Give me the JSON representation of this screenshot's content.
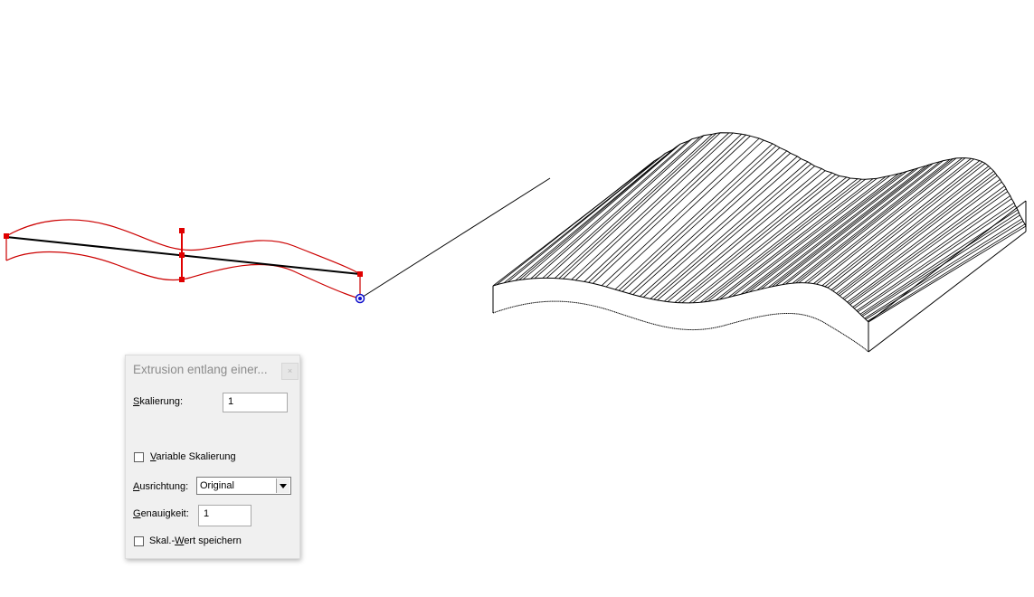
{
  "dialog": {
    "title": "Extrusion entlang einer...",
    "close_glyph": "×",
    "skalierung": {
      "key": "S",
      "rest": "kalierung:",
      "value": "1"
    },
    "variable_skalierung": {
      "key": "V",
      "rest": "ariable Skalierung",
      "checked": false
    },
    "ausrichtung": {
      "key": "A",
      "rest": "usrichtung:",
      "value": "Original"
    },
    "genauigkeit": {
      "key": "G",
      "rest": "enauigkeit:",
      "value": "1"
    },
    "wert_speichern": {
      "pre": "Skal.-",
      "key": "W",
      "rest": "ert speichern",
      "checked": false
    }
  },
  "colors": {
    "profile_red": "#cc0000",
    "handle_red": "#e00000",
    "base_point_blue": "#1010cc",
    "line_black": "#000000"
  },
  "icons": {
    "close": "close-icon",
    "dropdown": "chevron-down-icon"
  }
}
